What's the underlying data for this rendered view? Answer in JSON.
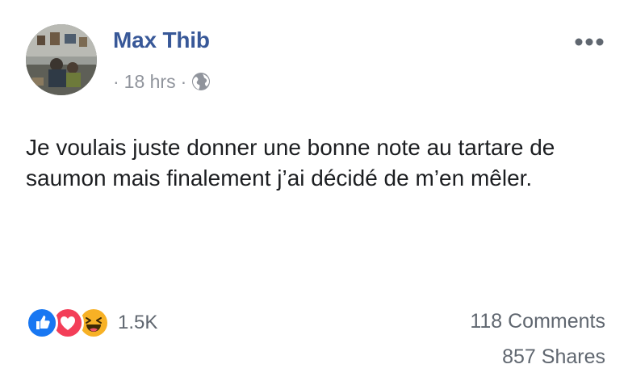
{
  "post": {
    "author": "Max Thib",
    "timestamp": "18 hrs",
    "separator": "·",
    "privacy_icon": "globe-icon",
    "more_icon": "more-options-icon",
    "text": "Je voulais juste donner une bonne note au tartare de saumon mais finalement j’ai décidé de m’en mêler."
  },
  "engagement": {
    "reaction_icons": [
      "like-icon",
      "love-icon",
      "haha-icon"
    ],
    "reaction_count": "1.5K",
    "comments": "118 Comments",
    "shares": "857 Shares"
  },
  "colors": {
    "author_name": "#385898",
    "meta_text": "#90949c",
    "like_blue": "#1877f2",
    "love_red": "#f33e58",
    "haha_yellow": "#f7b125"
  }
}
